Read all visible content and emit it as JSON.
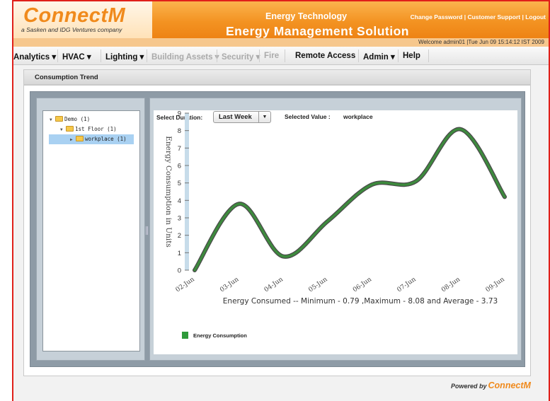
{
  "header": {
    "logo": "ConnectM",
    "logo_sub": "a Sasken and IDG Ventures company",
    "title_line1": "Energy Technology",
    "title_line2": "Energy Management Solution",
    "links": [
      "Change Password",
      "Customer Support",
      "Logout"
    ],
    "welcome": "Welcome admin01 |Tue Jun 09 15:14:12 IST 2009"
  },
  "nav": [
    {
      "label": "Analytics ▾",
      "disabled": false
    },
    {
      "label": "HVAC ▾",
      "disabled": false
    },
    {
      "label": "Lighting ▾",
      "disabled": false
    },
    {
      "label": "Building Assets ▾",
      "disabled": true
    },
    {
      "label": "Security ▾",
      "disabled": true
    },
    {
      "label": "Fire",
      "disabled": true
    },
    {
      "label": "Remote Access",
      "disabled": false
    },
    {
      "label": "Admin ▾",
      "disabled": false
    },
    {
      "label": "Help",
      "disabled": false
    }
  ],
  "panel": {
    "title": "Consumption Trend"
  },
  "tree": [
    {
      "label": "Demo (1)",
      "expanded": true,
      "selected": false
    },
    {
      "label": "1st Floor (1)",
      "expanded": true,
      "selected": false
    },
    {
      "label": "workplace (1)",
      "expanded": false,
      "selected": true
    }
  ],
  "controls": {
    "duration_label": "Select Duration:",
    "duration_value": "Last Week",
    "selected_label": "Selected Value :",
    "selected_value": "workplace"
  },
  "legend": {
    "label": "Energy Consumption",
    "color": "#2e9a3a"
  },
  "footer": {
    "powered_by": "Powered by",
    "brand": "ConnectM"
  },
  "chart_data": {
    "type": "line",
    "x": [
      "02-Jun",
      "03-Jun",
      "04-Jun",
      "05-Jun",
      "06-Jun",
      "07-Jun",
      "08-Jun",
      "09-Jun"
    ],
    "series": [
      {
        "name": "Energy Consumption",
        "values": [
          0,
          3.8,
          0.79,
          2.8,
          4.9,
          5.1,
          8.08,
          4.2
        ]
      }
    ],
    "ylabel": "Energy Consumption in Units",
    "xlabel": "Energy Consumed -- Minimum - 0.79 ,Maximum - 8.08 and Average - 3.73",
    "yticks": [
      0,
      1,
      2,
      3,
      4,
      5,
      6,
      7,
      8,
      9
    ],
    "ylim": [
      0,
      9
    ],
    "line_color": "#3d8a3d",
    "legend": "bottom-left"
  }
}
